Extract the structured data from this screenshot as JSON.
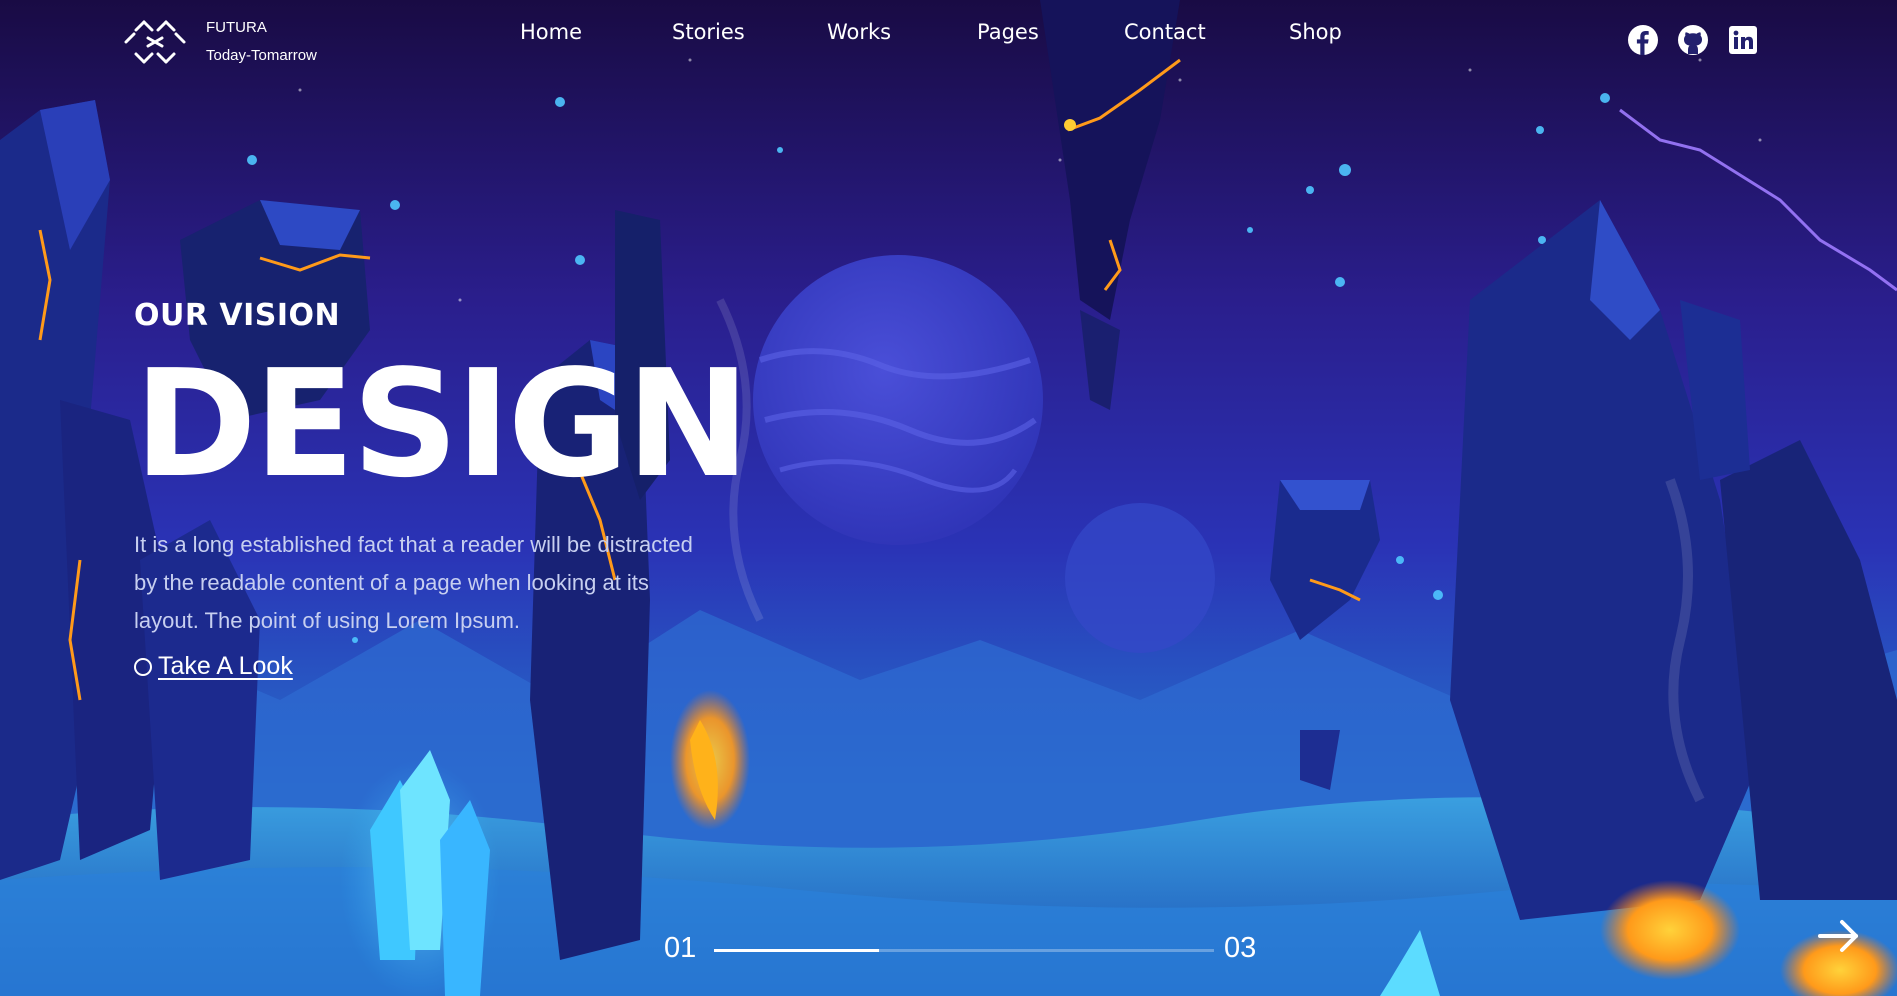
{
  "brand": {
    "name": "FUTURA",
    "tagline": "Today-Tomarrow"
  },
  "nav": [
    {
      "label": "Home"
    },
    {
      "label": "Stories"
    },
    {
      "label": "Works"
    },
    {
      "label": "Pages"
    },
    {
      "label": "Contact"
    },
    {
      "label": "Shop"
    }
  ],
  "social": [
    "facebook-icon",
    "github-icon",
    "linkedin-icon"
  ],
  "hero": {
    "eyebrow": "OUR VISION",
    "headline": "DESIGN",
    "description": "It is a long established fact that a reader will be distracted by the readable content of a page when looking at its layout. The point of using Lorem Ipsum.",
    "cta": "Take A Look"
  },
  "slider": {
    "current": "01",
    "total": "03",
    "progress": 0.33
  },
  "colors": {
    "sky_top": "#1a0b44",
    "sky_mid": "#2a2bb0",
    "sky_bottom": "#2f8ad2",
    "lava": "#ffb21a",
    "crystal": "#3fd2ff"
  }
}
